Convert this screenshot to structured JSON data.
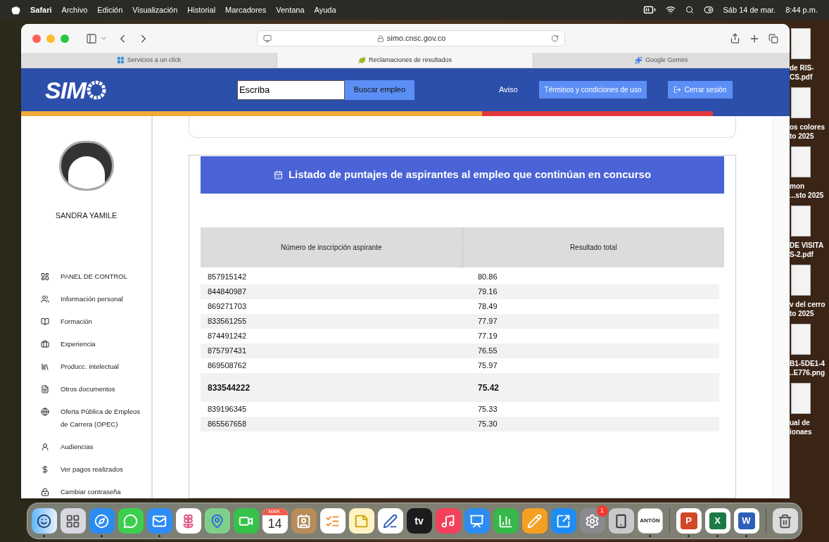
{
  "menubar": {
    "app": "Safari",
    "menus": [
      "Archivo",
      "Edición",
      "Visualización",
      "Historial",
      "Marcadores",
      "Ventana",
      "Ayuda"
    ],
    "date": "Sáb 14 de mar.",
    "time": "8:44 p.m."
  },
  "browser": {
    "url": "simo.cnsc.gov.co",
    "tabs": [
      {
        "label": "Servicios a un click",
        "selected": false,
        "kind": "square"
      },
      {
        "label": "Reclamaciones de resultados",
        "selected": true,
        "kind": "leaf"
      },
      {
        "label": "Google Gemini",
        "selected": false,
        "kind": "sparkle"
      }
    ]
  },
  "header": {
    "logo": "SIM",
    "search_value": "Escriba",
    "search_button": "Buscar empleo",
    "notice_link": "Aviso",
    "terms_button": "Términos y condiciones de uso",
    "logout_button": "Cerrar sesión"
  },
  "sidebar": {
    "user_name": "SANDRA YAMILE",
    "items": [
      {
        "label": "PANEL DE CONTROL",
        "kind": "dashboard"
      },
      {
        "label": "Información personal",
        "kind": "people"
      },
      {
        "label": "Formación",
        "kind": "reader"
      },
      {
        "label": "Experiencia",
        "kind": "briefcase"
      },
      {
        "label": "Producc. intelectual",
        "kind": "library"
      },
      {
        "label": "Otros documentos",
        "kind": "document"
      },
      {
        "label": "Oferta Pública de Empleos de Carrera (OPEC)",
        "kind": "globe"
      },
      {
        "label": "Audiencias",
        "kind": "speaker"
      },
      {
        "label": "Ver pagos realizados",
        "kind": "dollar"
      },
      {
        "label": "Cambiar contraseña",
        "kind": "lock"
      }
    ]
  },
  "scores": {
    "title": "Listado de puntajes de aspirantes al empleo que continúan en concurso",
    "columns": [
      "Número de inscripción aspirante",
      "Resultado total"
    ],
    "rows": [
      {
        "id": "857915142",
        "total": "80.86",
        "highlighted": false
      },
      {
        "id": "844840987",
        "total": "79.16",
        "highlighted": false
      },
      {
        "id": "869271703",
        "total": "78.49",
        "highlighted": false
      },
      {
        "id": "833561255",
        "total": "77.97",
        "highlighted": false
      },
      {
        "id": "874491242",
        "total": "77.19",
        "highlighted": false
      },
      {
        "id": "875797431",
        "total": "76.55",
        "highlighted": false
      },
      {
        "id": "869508762",
        "total": "75.97",
        "highlighted": false
      },
      {
        "id": "833544222",
        "total": "75.42",
        "highlighted": true
      },
      {
        "id": "839196345",
        "total": "75.33",
        "highlighted": false
      },
      {
        "id": "865567658",
        "total": "75.30",
        "highlighted": false
      }
    ]
  },
  "desktop_files": [
    {
      "lines": [
        "de RIS-",
        "CS.pdf"
      ]
    },
    {
      "lines": [
        "os colores",
        "to 2025"
      ]
    },
    {
      "lines": [
        "mon",
        "...sto 2025"
      ]
    },
    {
      "lines": [
        "DE VISITA",
        "S-2.pdf"
      ]
    },
    {
      "lines": [
        "v del cerro",
        "to 2025"
      ]
    },
    {
      "lines": [
        "B1-5DE1-4",
        "..E776.png"
      ]
    },
    {
      "lines": [
        "ual de",
        "ionaes"
      ]
    }
  ],
  "dock": [
    {
      "kind": "finder",
      "running": true
    },
    {
      "kind": "launchpad",
      "running": false
    },
    {
      "kind": "safari",
      "running": true
    },
    {
      "kind": "messages",
      "running": false
    },
    {
      "kind": "mail",
      "running": true
    },
    {
      "kind": "photos",
      "running": false
    },
    {
      "kind": "maps",
      "running": false
    },
    {
      "kind": "facetime",
      "running": false
    },
    {
      "kind": "calendar",
      "running": false,
      "month": "MAR.",
      "day": "14"
    },
    {
      "kind": "contacts",
      "running": false
    },
    {
      "kind": "reminders",
      "running": false
    },
    {
      "kind": "notes",
      "running": false
    },
    {
      "kind": "freeform",
      "running": false
    },
    {
      "kind": "tv",
      "running": false,
      "label": "tv"
    },
    {
      "kind": "music",
      "running": false
    },
    {
      "kind": "keynote",
      "running": false
    },
    {
      "kind": "numbers",
      "running": false
    },
    {
      "kind": "pages",
      "running": false
    },
    {
      "kind": "appstore",
      "running": false
    },
    {
      "kind": "settings",
      "running": false,
      "badge": "1"
    },
    {
      "kind": "iphone",
      "running": false
    },
    {
      "kind": "anton",
      "running": true,
      "label": "ANTÓN"
    },
    {
      "kind": "separator"
    },
    {
      "kind": "office",
      "running": true,
      "label": "P",
      "color": "#d24726"
    },
    {
      "kind": "office",
      "running": true,
      "label": "X",
      "color": "#1d7a45"
    },
    {
      "kind": "office",
      "running": true,
      "label": "W",
      "color": "#2b5fb9"
    },
    {
      "kind": "separator"
    },
    {
      "kind": "trash",
      "running": false
    }
  ]
}
